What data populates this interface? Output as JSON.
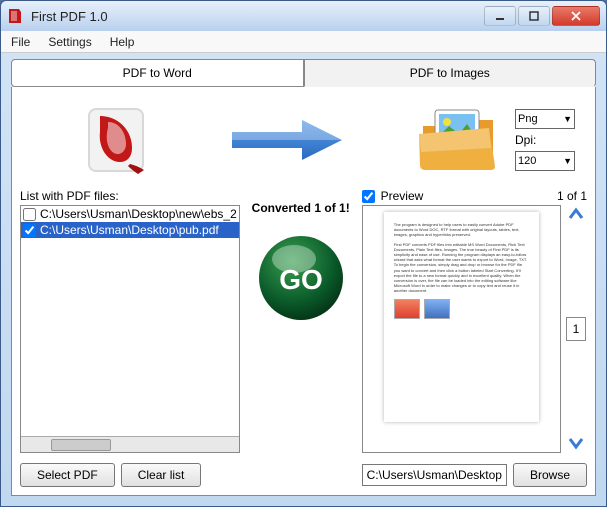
{
  "window": {
    "title": "First PDF 1.0"
  },
  "menu": {
    "file": "File",
    "settings": "Settings",
    "help": "Help"
  },
  "tabs": {
    "word": "PDF to Word",
    "images": "PDF to Images"
  },
  "format": {
    "select_value": "Png",
    "dpi_label": "Dpi:",
    "dpi_value": "120"
  },
  "left": {
    "label": "List with PDF files:",
    "files": [
      {
        "checked": false,
        "path": "C:\\Users\\Usman\\Desktop\\new\\ebs_2"
      },
      {
        "checked": true,
        "path": "C:\\Users\\Usman\\Desktop\\pub.pdf"
      }
    ],
    "select_btn": "Select PDF",
    "clear_btn": "Clear list"
  },
  "center": {
    "status": "Converted 1 of 1!",
    "go_label": "GO"
  },
  "right": {
    "preview_label": "Preview",
    "page_count": "1 of 1",
    "page_num": "1",
    "output_path": "C:\\Users\\Usman\\Desktop",
    "browse_btn": "Browse"
  }
}
